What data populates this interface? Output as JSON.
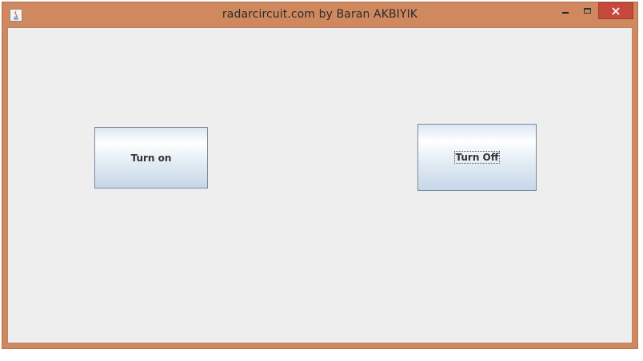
{
  "window": {
    "title": "radarcircuit.com by Baran AKBIYIK",
    "frame_color": "#d0895e",
    "close_button_color": "#c7483c",
    "client_background": "#eeeeee",
    "icon": "java-app-icon",
    "controls": {
      "minimize_icon": "minimize-icon",
      "maximize_icon": "maximize-icon",
      "close_label": "✕"
    }
  },
  "buttons": {
    "turn_on_label": "Turn on",
    "turn_off_label": "Turn Off"
  }
}
